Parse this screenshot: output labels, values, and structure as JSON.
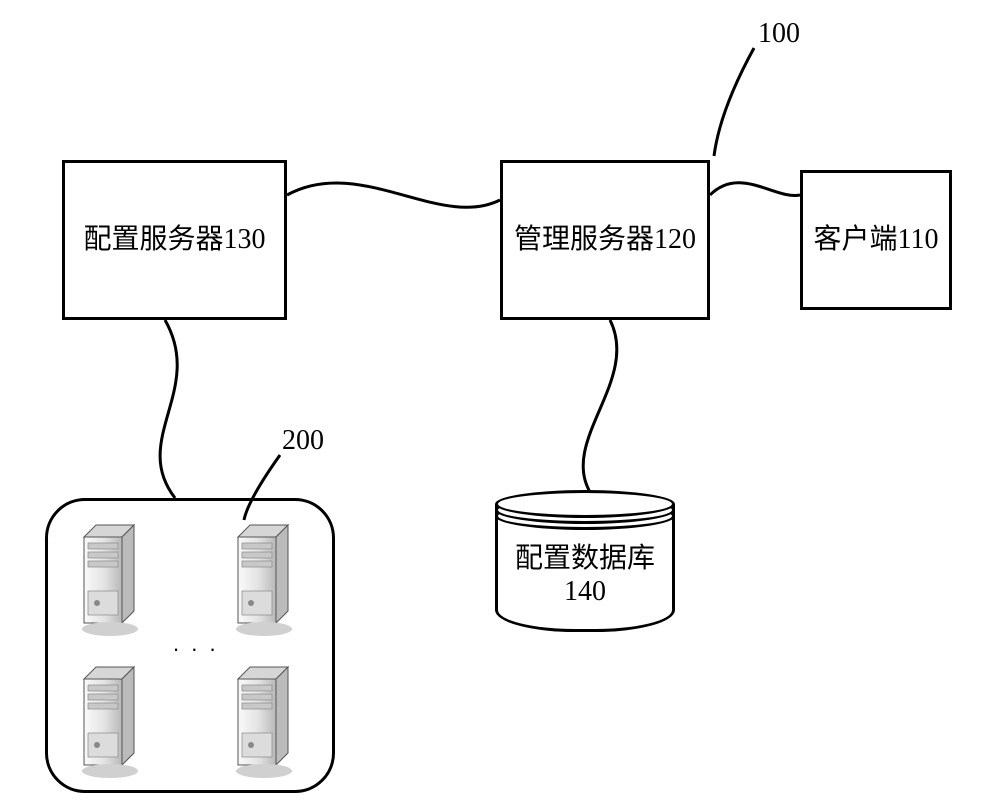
{
  "labels": {
    "system_id": "100",
    "cluster_id": "200"
  },
  "nodes": {
    "config_server": "配置服务器130",
    "mgmt_server": "管理服务器120",
    "client": "客户端110",
    "config_db_line1": "配置数据库",
    "config_db_line2": "140"
  },
  "cluster": {
    "ellipsis": ". . ."
  }
}
